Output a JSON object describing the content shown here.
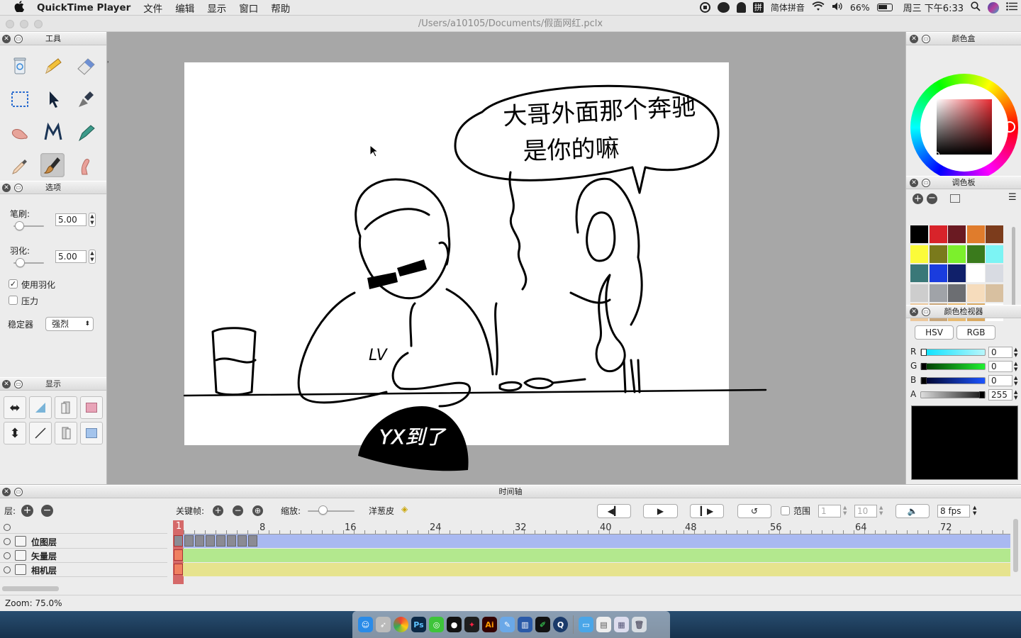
{
  "menubar": {
    "apple": "",
    "app_name": "QuickTime Player",
    "items": [
      "文件",
      "编辑",
      "显示",
      "窗口",
      "帮助"
    ],
    "input_method": "简体拼音",
    "battery": "66%",
    "datetime": "周三 下午6:33"
  },
  "window": {
    "title": "/Users/a10105/Documents/假面网红.pclx"
  },
  "panels": {
    "tools": "工具",
    "options": "选项",
    "display": "显示",
    "color_box": "颜色盒",
    "palette": "调色板",
    "color_inspector": "颜色检视器",
    "timeline": "时间轴"
  },
  "options": {
    "brush_label": "笔刷:",
    "brush_value": "5.00",
    "feather_label": "羽化:",
    "feather_value": "5.00",
    "use_feather": "使用羽化",
    "pressure": "压力",
    "stabilizer_label": "稳定器",
    "stabilizer_value": "强烈"
  },
  "drawing": {
    "speech_line1": "大哥外面那个奔驰",
    "speech_line2": "是你的嘛",
    "shirt_text": "LV",
    "sign_text": "YX到了"
  },
  "inspector": {
    "hsv": "HSV",
    "rgb": "RGB",
    "r_label": "R",
    "r_value": "0",
    "g_label": "G",
    "g_value": "0",
    "b_label": "B",
    "b_value": "0",
    "a_label": "A",
    "a_value": "255",
    "current_color": "#000000"
  },
  "palette_colors": [
    "#000000",
    "#d8232a",
    "#6a1a22",
    "#e07c2c",
    "#7c3c1c",
    "#fbfb3a",
    "#7a7a1c",
    "#7cf02c",
    "#3a7a1c",
    "#7cf4f4",
    "#3a7878",
    "#1a3cde",
    "#10206a",
    "#ffffff",
    "#d8dbe2",
    "#cdcdcd",
    "#a0a3a8",
    "#6c6e72",
    "#f6dcbc",
    "#d8c0a0",
    "#ecc89c",
    "#c8a67a",
    "#e8ba70",
    "#d8a860",
    "#ffffff"
  ],
  "timeline": {
    "layers_label": "层:",
    "keyframe_label": "关键帧:",
    "zoom_label": "缩放:",
    "onion_label": "洋葱皮",
    "range_label": "范围",
    "range_start": "1",
    "range_end": "10",
    "fps": "8 fps",
    "ruler": [
      "1",
      "8",
      "16",
      "24",
      "32",
      "40",
      "48",
      "56",
      "64",
      "72"
    ],
    "layers": [
      "位图层",
      "矢量层",
      "相机层"
    ]
  },
  "status": {
    "zoom": "Zoom: 75.0%"
  }
}
